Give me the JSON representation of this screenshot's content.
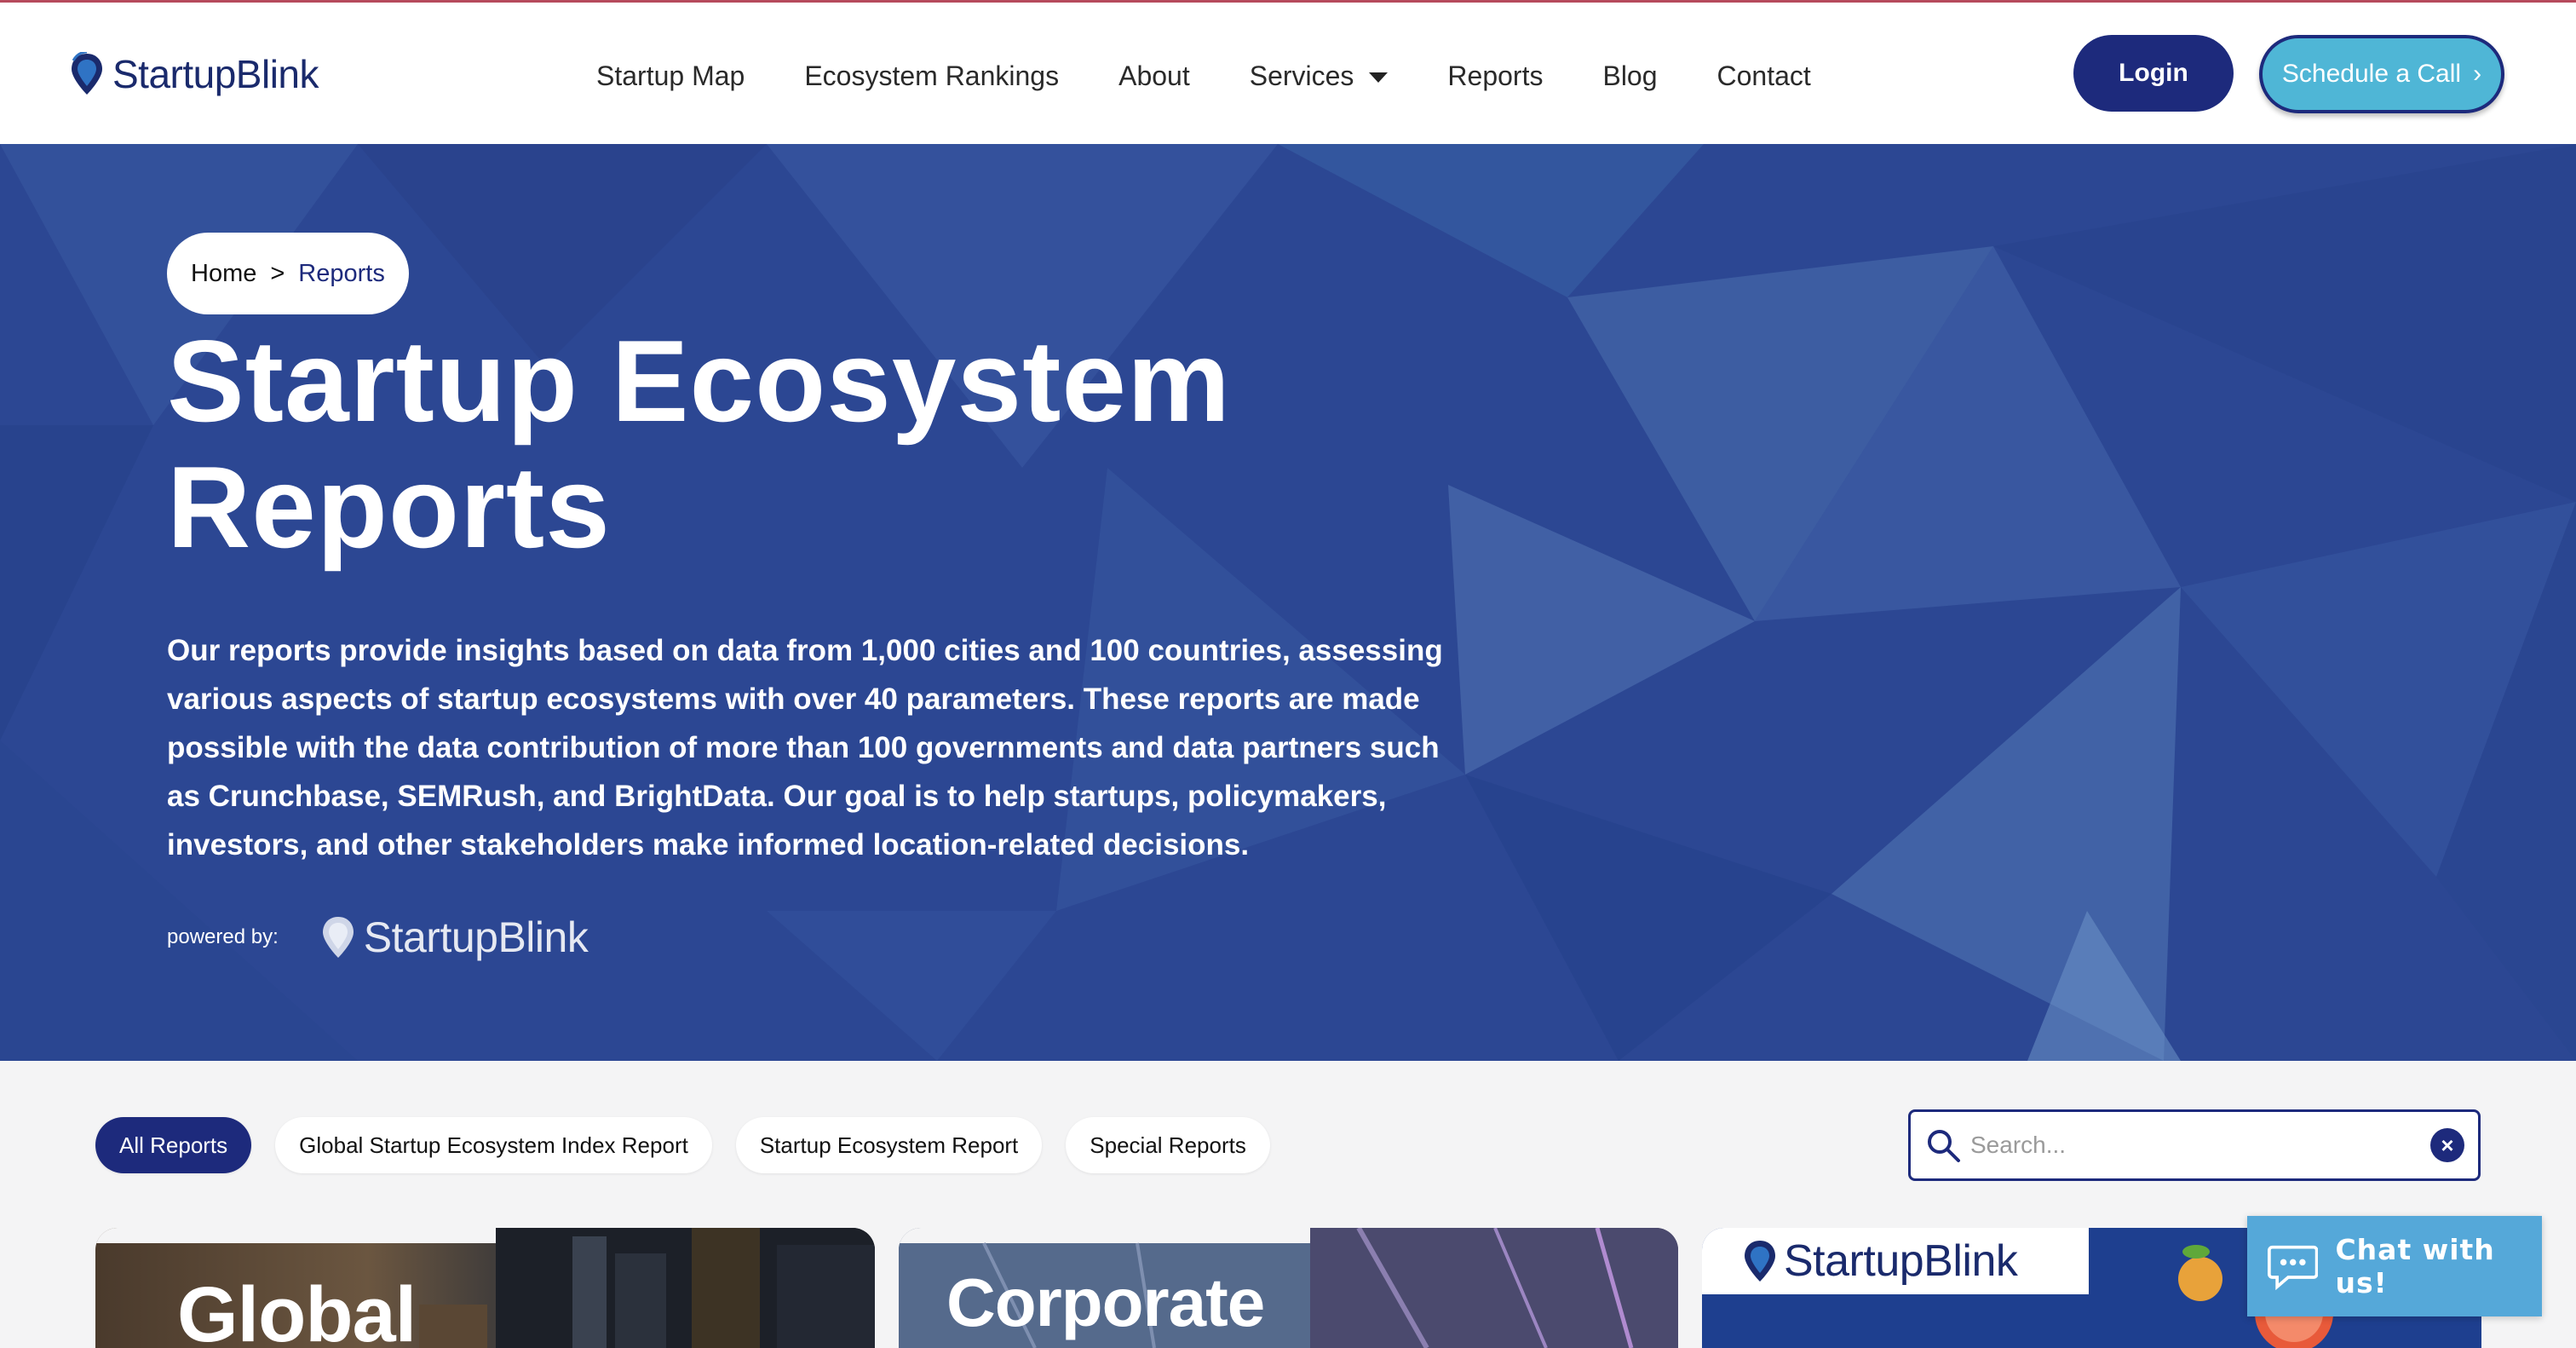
{
  "brand": {
    "name": "StartupBlink"
  },
  "nav": {
    "items": [
      {
        "label": "Startup Map"
      },
      {
        "label": "Ecosystem Rankings"
      },
      {
        "label": "About"
      },
      {
        "label": "Services"
      },
      {
        "label": "Reports"
      },
      {
        "label": "Blog"
      },
      {
        "label": "Contact"
      }
    ],
    "login_label": "Login",
    "schedule_label": "Schedule a Call"
  },
  "hero": {
    "breadcrumb": {
      "home": "Home",
      "separator": ">",
      "current": "Reports"
    },
    "title_line1": "Startup Ecosystem",
    "title_line2": "Reports",
    "description": "Our reports provide insights based on data from 1,000 cities and 100 countries, assessing various aspects of startup ecosystems with over 40 parameters. These reports are made possible with the data contribution of more than 100 governments and data partners such as Crunchbase, SEMRush, and BrightData. Our goal is to help startups, policymakers, investors, and other stakeholders make informed location-related decisions.",
    "powered_by_label": "powered by:",
    "powered_by_brand": "StartupBlink"
  },
  "filters": {
    "chips": [
      {
        "label": "All Reports",
        "active": true
      },
      {
        "label": "Global Startup Ecosystem Index Report",
        "active": false
      },
      {
        "label": "Startup Ecosystem Report",
        "active": false
      },
      {
        "label": "Special Reports",
        "active": false
      }
    ],
    "search_placeholder": "Search...",
    "clear_symbol": "×"
  },
  "cards": [
    {
      "title": "Global"
    },
    {
      "title": "Corporate"
    },
    {
      "brand": "StartupBlink"
    }
  ],
  "chat": {
    "label": "Chat with us!"
  },
  "colors": {
    "primary": "#1d2a7c",
    "accent": "#4fb6d6",
    "hero_bg": "#2b4590",
    "chat_bg": "#55a8d9"
  }
}
